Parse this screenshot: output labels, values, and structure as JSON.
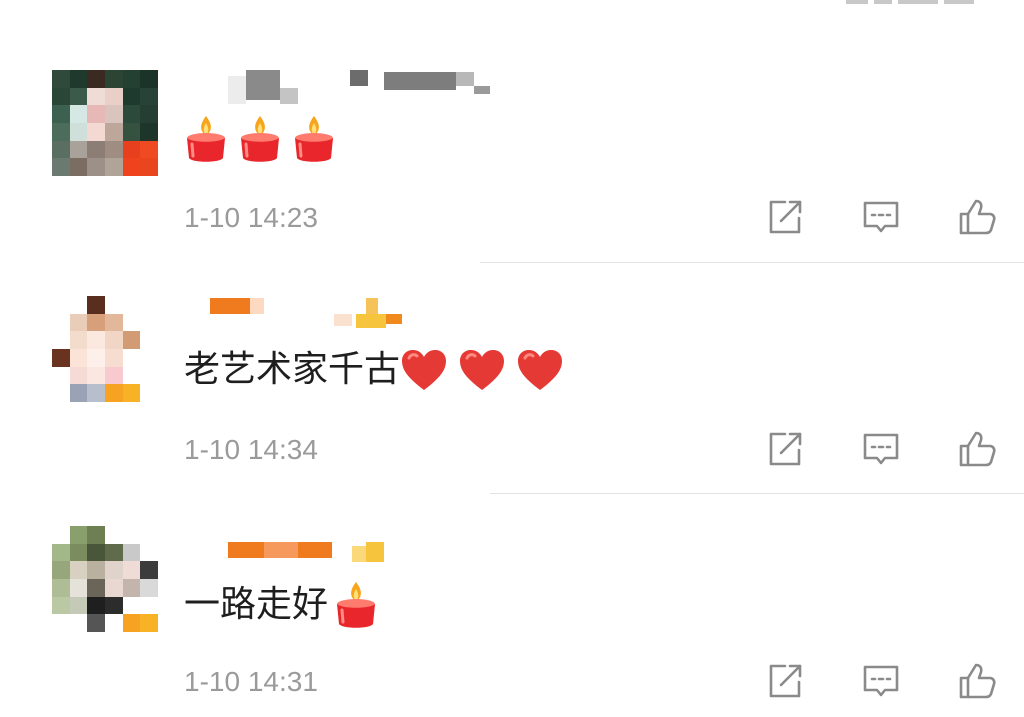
{
  "comments": [
    {
      "content_text": "",
      "content_emojis": [
        "candle-emoji",
        "candle-emoji",
        "candle-emoji"
      ],
      "time": "1-10 14:23"
    },
    {
      "content_text": "老艺术家千古",
      "content_emojis": [
        "heart-emoji",
        "heart-emoji",
        "heart-emoji"
      ],
      "time": "1-10 14:34"
    },
    {
      "content_text": "一路走好",
      "content_emojis": [
        "candle-emoji"
      ],
      "time": "1-10 14:31"
    }
  ],
  "actions": [
    "share-icon",
    "comment-icon",
    "like-icon"
  ],
  "colors": {
    "time": "#9a9a9a",
    "icon": "#8a8a8a",
    "divider": "#e2e2e2",
    "candle_body": "#e8262b",
    "flame": "#f7a51c",
    "heart": "#e53935"
  }
}
